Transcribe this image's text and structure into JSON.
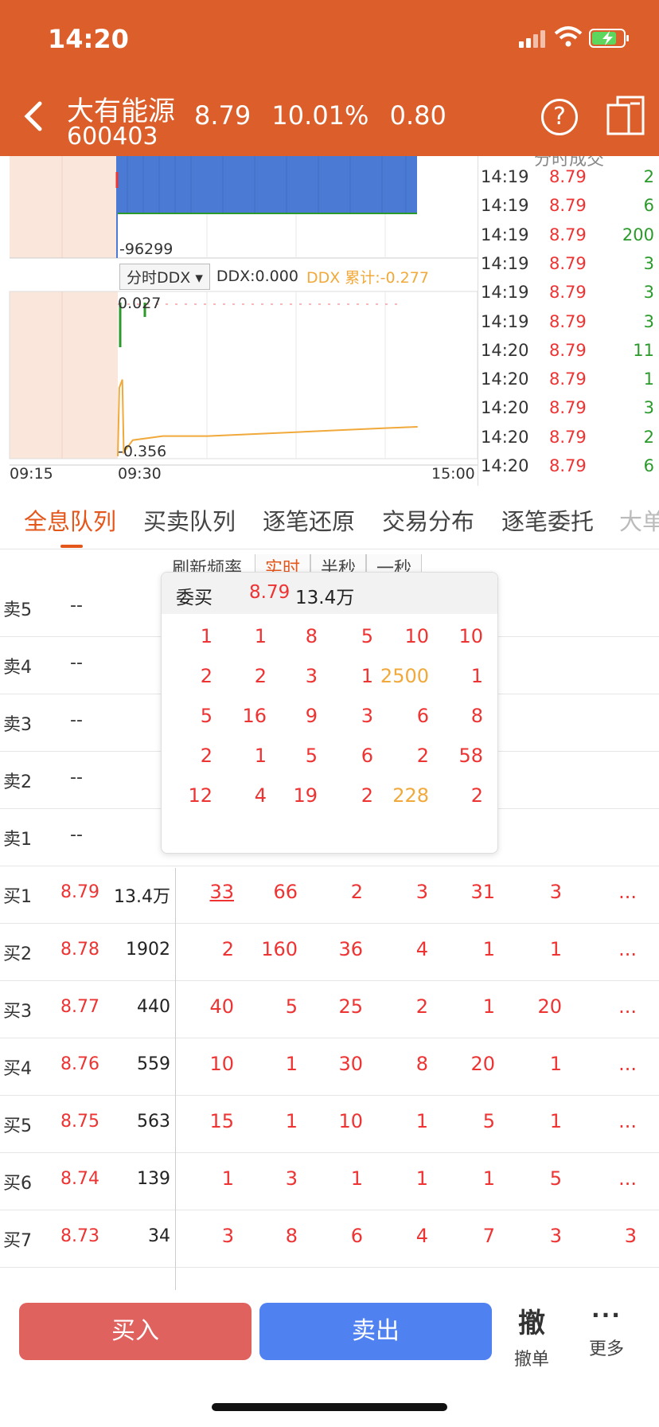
{
  "status_bar": {
    "time": "14:20"
  },
  "header": {
    "stock_name": "大有能源",
    "stock_code": "600403",
    "price": "8.79",
    "change_pct": "10.01%",
    "change": "0.80",
    "help_glyph": "?"
  },
  "chart": {
    "volume_min_label": "-96299",
    "ddx_select": "分时DDX",
    "ddx_value": "DDX:0.000",
    "ddx_cumulative": "DDX 累计:-0.277",
    "ddx_max_label": "0.027",
    "ddx_min_label": "-0.356",
    "time_labels": [
      "09:15",
      "09:30",
      "15:00"
    ],
    "ddx_cum_series": [
      {
        "time": "09:30",
        "value": -0.35
      },
      {
        "time": "09:31",
        "value": -0.18
      },
      {
        "time": "09:33",
        "value": -0.16
      },
      {
        "time": "09:34",
        "value": -0.34
      },
      {
        "time": "09:40",
        "value": -0.31
      },
      {
        "time": "10:00",
        "value": -0.3
      },
      {
        "time": "10:30",
        "value": -0.3
      },
      {
        "time": "11:00",
        "value": -0.295
      },
      {
        "time": "13:00",
        "value": -0.29
      },
      {
        "time": "13:30",
        "value": -0.285
      },
      {
        "time": "14:00",
        "value": -0.28
      },
      {
        "time": "14:20",
        "value": -0.277
      }
    ]
  },
  "trades": {
    "title": "分时成交",
    "rows": [
      {
        "time": "14:19",
        "price": "8.79",
        "vol": "2"
      },
      {
        "time": "14:19",
        "price": "8.79",
        "vol": "6"
      },
      {
        "time": "14:19",
        "price": "8.79",
        "vol": "200"
      },
      {
        "time": "14:19",
        "price": "8.79",
        "vol": "3"
      },
      {
        "time": "14:19",
        "price": "8.79",
        "vol": "3"
      },
      {
        "time": "14:19",
        "price": "8.79",
        "vol": "3"
      },
      {
        "time": "14:20",
        "price": "8.79",
        "vol": "11"
      },
      {
        "time": "14:20",
        "price": "8.79",
        "vol": "1"
      },
      {
        "time": "14:20",
        "price": "8.79",
        "vol": "3"
      },
      {
        "time": "14:20",
        "price": "8.79",
        "vol": "2"
      },
      {
        "time": "14:20",
        "price": "8.79",
        "vol": "6"
      }
    ]
  },
  "tabs": [
    "全息队列",
    "买卖队列",
    "逐笔还原",
    "交易分布",
    "逐笔委托",
    "大单"
  ],
  "refresh": {
    "label": "刷新频率",
    "options": [
      "实时",
      "半秒",
      "一秒"
    ]
  },
  "sell_rows": [
    {
      "label": "卖5",
      "price": "--"
    },
    {
      "label": "卖4",
      "price": "--"
    },
    {
      "label": "卖3",
      "price": "--"
    },
    {
      "label": "卖2",
      "price": "--"
    },
    {
      "label": "卖1",
      "price": "--"
    }
  ],
  "buy_rows": [
    {
      "label": "买1",
      "price": "8.79",
      "vol": "13.4万",
      "q": [
        "33",
        "66",
        "2",
        "3",
        "31",
        "3",
        "..."
      ]
    },
    {
      "label": "买2",
      "price": "8.78",
      "vol": "1902",
      "q": [
        "2",
        "160",
        "36",
        "4",
        "1",
        "1",
        "..."
      ]
    },
    {
      "label": "买3",
      "price": "8.77",
      "vol": "440",
      "q": [
        "40",
        "5",
        "25",
        "2",
        "1",
        "20",
        "..."
      ]
    },
    {
      "label": "买4",
      "price": "8.76",
      "vol": "559",
      "q": [
        "10",
        "1",
        "30",
        "8",
        "20",
        "1",
        "..."
      ]
    },
    {
      "label": "买5",
      "price": "8.75",
      "vol": "563",
      "q": [
        "15",
        "1",
        "10",
        "1",
        "5",
        "1",
        "..."
      ]
    },
    {
      "label": "买6",
      "price": "8.74",
      "vol": "139",
      "q": [
        "1",
        "3",
        "1",
        "1",
        "1",
        "5",
        "..."
      ]
    },
    {
      "label": "买7",
      "price": "8.73",
      "vol": "34",
      "q": [
        "3",
        "8",
        "6",
        "4",
        "7",
        "3",
        "3"
      ]
    }
  ],
  "popup": {
    "label": "委买",
    "price": "8.79",
    "vol": "13.4万",
    "grid": [
      [
        "1",
        "1",
        "8",
        "5",
        "10",
        "10"
      ],
      [
        "2",
        "2",
        "3",
        "1",
        "2500",
        "1"
      ],
      [
        "5",
        "16",
        "9",
        "3",
        "6",
        "8"
      ],
      [
        "2",
        "1",
        "5",
        "6",
        "2",
        "58"
      ],
      [
        "12",
        "4",
        "19",
        "2",
        "228",
        "2"
      ]
    ],
    "highlight": [
      "2500",
      "228"
    ]
  },
  "bottom_bar": {
    "buy": "买入",
    "sell": "卖出",
    "cancel_glyph": "撤",
    "cancel": "撤单",
    "more_glyph": "···",
    "more": "更多"
  },
  "colors": {
    "header_bg": "#dc5f2b",
    "up_red": "#e33333",
    "down_green": "#2a9a2a",
    "volume_blue": "#4a7ad4",
    "ddx_gold": "#f0a93a",
    "buy_button": "#e0625f",
    "sell_button": "#4f82f0"
  }
}
